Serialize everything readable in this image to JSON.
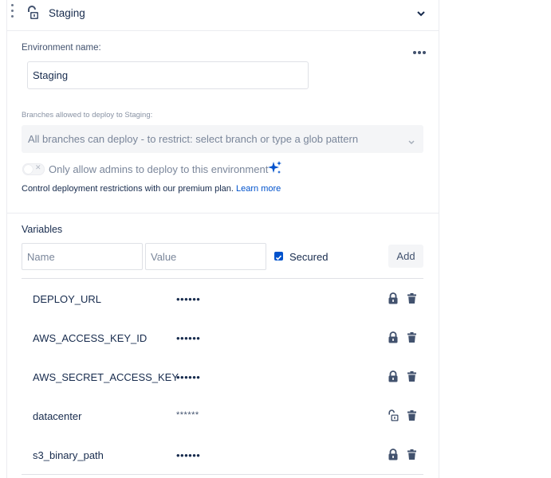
{
  "header": {
    "title": "Staging"
  },
  "environment": {
    "name_label": "Environment name:",
    "name_value": "Staging",
    "branches_label": "Branches allowed to deploy to Staging:",
    "branches_placeholder": "All branches can deploy - to restrict: select branch or type a glob pattern",
    "admins_label": "Only allow admins to deploy to this environment",
    "premium_text": "Control deployment restrictions with our premium plan. ",
    "learn_more": "Learn more"
  },
  "variables": {
    "title": "Variables",
    "name_placeholder": "Name",
    "value_placeholder": "Value",
    "secured_label": "Secured",
    "add_label": "Add",
    "items": [
      {
        "name": "DEPLOY_URL",
        "value": "••••••",
        "secured": true
      },
      {
        "name": "AWS_ACCESS_KEY_ID",
        "value": "••••••",
        "secured": true
      },
      {
        "name": "AWS_SECRET_ACCESS_KEY",
        "value": "••••••",
        "secured": true
      },
      {
        "name": "datacenter",
        "value": "******",
        "secured": false
      },
      {
        "name": "s3_binary_path",
        "value": "••••••",
        "secured": true
      }
    ]
  },
  "icons": {
    "header_lock": "lock-open-icon",
    "collapse": "chevron-down-icon",
    "more": "more-horizontal-icon",
    "sparkle": "sparkle-icon",
    "row_lock": "lock-icon",
    "row_unlock": "lock-open-icon",
    "trash": "trash-icon"
  },
  "colors": {
    "accent": "#0052cc",
    "text": "#172b4d",
    "muted": "#7a869a"
  }
}
